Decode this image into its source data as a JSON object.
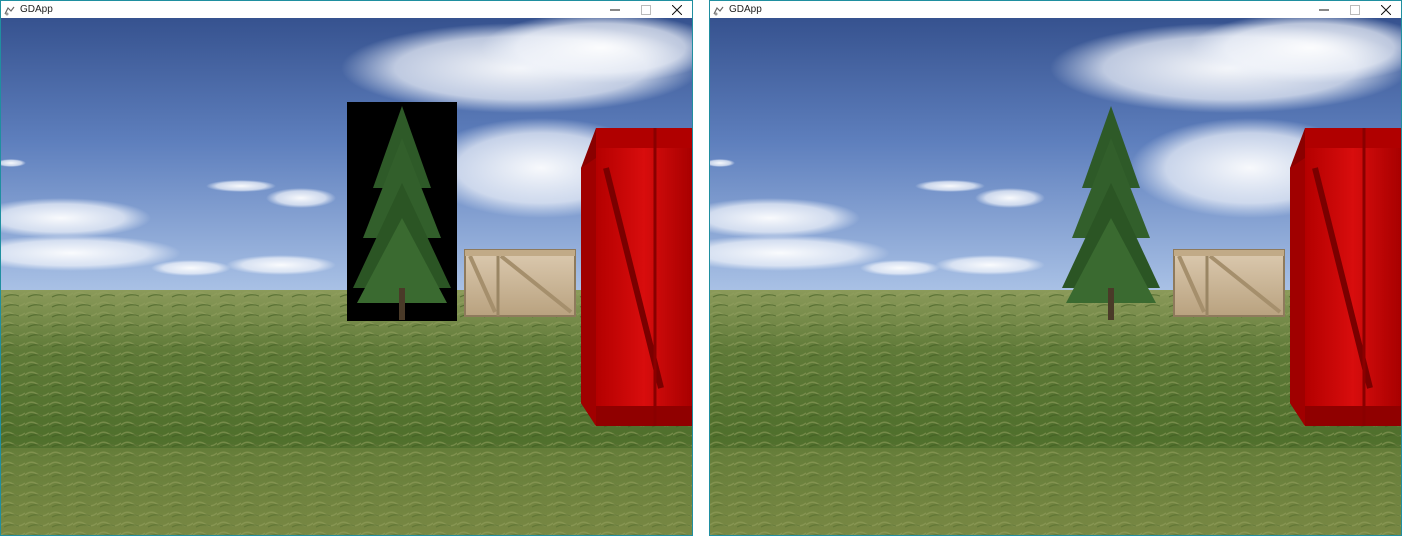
{
  "windows": [
    {
      "title": "GDApp",
      "tree_background": "black",
      "icons": [
        "app-icon",
        "minimize-icon",
        "maximize-icon",
        "close-icon"
      ]
    },
    {
      "title": "GDApp",
      "tree_background": "transparent",
      "icons": [
        "app-icon",
        "minimize-icon",
        "maximize-icon",
        "close-icon"
      ]
    }
  ],
  "colors": {
    "sky_top": "#3f5a9a",
    "sky_mid": "#6e8ec6",
    "sky_horizon": "#a9c0e4",
    "ground_far": "#7a8c4e",
    "ground_near": "#4d6a2c",
    "red_crate": "#c00000",
    "wood_crate": "#cdb99a",
    "tree": "#2f5b2a",
    "window_border": "#1f8fa0"
  }
}
